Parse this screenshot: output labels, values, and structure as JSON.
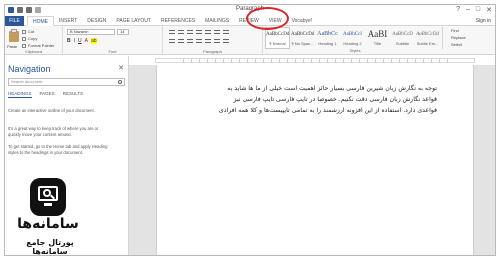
{
  "window": {
    "title": "Paragraph",
    "controls": [
      "?",
      "–",
      "□",
      "✕"
    ]
  },
  "ribbon_tabs": {
    "file": "FILE",
    "tabs": [
      "HOME",
      "INSERT",
      "DESIGN",
      "PAGE LAYOUT",
      "REFERENCES",
      "MAILINGS",
      "REVIEW",
      "VIEW",
      "Vocabye!"
    ],
    "active_index": 0,
    "user": "Sign in"
  },
  "clipboard": {
    "paste": "Paste",
    "cut": "Cut",
    "copy": "Copy",
    "format_painter": "Format Painter",
    "label": "Clipboard"
  },
  "font": {
    "name": "B Nazanin",
    "size": "14",
    "bold": "B",
    "italic": "I",
    "underline": "U",
    "label": "Font"
  },
  "paragraph": {
    "label": "Paragraph"
  },
  "styles": {
    "items": [
      {
        "sample": "AaBbCcDd",
        "name": "¶ Normal"
      },
      {
        "sample": "AaBbCcDd",
        "name": "¶ No Spac..."
      },
      {
        "sample": "AaBbCc",
        "name": "Heading 1"
      },
      {
        "sample": "AaBbCcI",
        "name": "Heading 2"
      },
      {
        "sample": "AaBI",
        "name": "Title"
      },
      {
        "sample": "AaBbCcD",
        "name": "Subtitle"
      },
      {
        "sample": "AaBbCcDd",
        "name": "Subtle Em..."
      }
    ],
    "label": "Styles"
  },
  "editing": {
    "find": "Find",
    "replace": "Replace",
    "select": "Select"
  },
  "navigation": {
    "title": "Navigation",
    "close": "✕",
    "search_placeholder": "Search document",
    "tabs": [
      "HEADINGS",
      "PAGES",
      "RESULTS"
    ],
    "info1": "Create an interactive outline of your document.",
    "info2": "It's a great way to keep track of where you are or quickly move your content around.",
    "info3": "To get started, go to the Home tab and apply Heading styles to the headings in your document."
  },
  "document": {
    "lines": [
      "توجه به نگارش زبان شیرین فارسی بسیار حائز اهمیت است خیلی از ما ها شاید به",
      "قواعد نگارش زبان فارسی دقت نکنیم. خصوصا در تایپ فارسی تایپ فارسی نیز",
      "قواعدی دارد. استفاده از این افزونه ارزشمند را به تمامی تایپیست‌ها و کلا همه افرادی"
    ]
  },
  "logo": {
    "name": "سامانه‌ها",
    "subtitle": "پورتال جامع سامانه‌ها"
  },
  "colors": {
    "accent": "#2b579a",
    "highlight": "#d9262b"
  }
}
